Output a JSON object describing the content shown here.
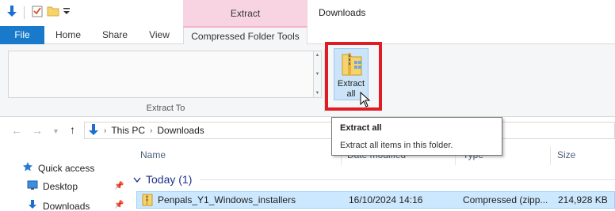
{
  "window": {
    "title": "Downloads",
    "context_group": "Extract"
  },
  "tabs": {
    "file": "File",
    "home": "Home",
    "share": "Share",
    "view": "View",
    "compressed": "Compressed Folder Tools"
  },
  "ribbon": {
    "group_label": "Extract To",
    "extract_all_label_1": "Extract",
    "extract_all_label_2": "all"
  },
  "address": {
    "crumbs": [
      "This PC",
      "Downloads"
    ]
  },
  "nav_pane": {
    "items": [
      "Quick access",
      "Desktop",
      "Downloads"
    ]
  },
  "file_list": {
    "columns": {
      "name": "Name",
      "date": "Date modified",
      "type": "Type",
      "size": "Size"
    },
    "group": "Today (1)",
    "rows": [
      {
        "name": "Penpals_Y1_Windows_installers",
        "date": "16/10/2024 14:16",
        "type": "Compressed (zipp...",
        "size": "214,928 KB"
      }
    ]
  },
  "tooltip": {
    "title": "Extract all",
    "body": "Extract all items in this folder."
  },
  "colors": {
    "file_tab": "#1979ca",
    "context_tab": "#f8d4e3",
    "highlight": "#e01b24",
    "selection": "#cce8ff"
  },
  "icons": [
    "down-arrow-icon",
    "properties-icon",
    "folder-icon",
    "qat-dropdown-icon",
    "extract-all-icon",
    "pc-icon",
    "star-icon",
    "desktop-icon",
    "downloads-icon",
    "pin-icon",
    "zip-icon",
    "cursor-icon"
  ]
}
